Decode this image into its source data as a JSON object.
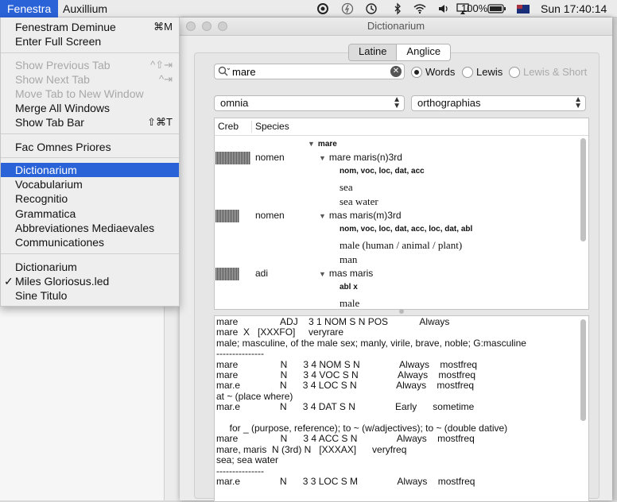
{
  "menubar": {
    "menus": [
      "Fenestra",
      "Auxillium"
    ],
    "battery": "100%",
    "clock": "Sun 17:40:14"
  },
  "window": {
    "title": "Dictionarium",
    "tabs": [
      "Latine",
      "Anglice"
    ],
    "search_value": "mare",
    "radios": [
      "Words",
      "Lewis",
      "Lewis & Short"
    ],
    "select_left": "omnia",
    "select_right": "orthographias",
    "columns": [
      "Creb",
      "Species"
    ],
    "outline": {
      "r0": "mare",
      "r1_species": "nomen",
      "r1": "mare maris(n)3rd",
      "r1_forms": "nom, voc, loc, dat, acc",
      "r1_m1": "sea",
      "r1_m2": "sea water",
      "r2_species": "nomen",
      "r2": "mas maris(m)3rd",
      "r2_forms": "nom, voc, loc, dat, acc, loc, dat, abl",
      "r2_m1": "male (human / animal / plant)",
      "r2_m2": "man",
      "r3_species": "adi",
      "r3": "mas maris",
      "r3_forms": "abl x",
      "r3_m1": "male"
    },
    "text_output": "mare                ADJ    3 1 NOM S N POS            Always\nmare  X   [XXXFO]     veryrare\nmale; masculine, of the male sex; manly, virile, brave, noble; G:masculine\n---------------\nmare                N      3 4 NOM S N               Always    mostfreq\nmare                N      3 4 VOC S N               Always    mostfreq\nmar.e               N      3 4 LOC S N               Always    mostfreq\nat ~ (place where)\nmar.e               N      3 4 DAT S N               Early      sometime\n\n     for _ (purpose, reference); to ~ (w/adjectives); to ~ (double dative)\nmare                N      3 4 ACC S N               Always    mostfreq\nmare, maris  N (3rd) N   [XXXAX]      veryfreq\nsea; sea water\n---------------\nmar.e               N      3 3 LOC S M               Always    mostfreq"
  },
  "fenestra_menu": {
    "g1": [
      {
        "label": "Fenestram Deminue",
        "shortcut": "⌘M"
      },
      {
        "label": "Enter Full Screen",
        "shortcut": ""
      }
    ],
    "g2": [
      {
        "label": "Show Previous Tab",
        "shortcut": "^⇧⇥"
      },
      {
        "label": "Show Next Tab",
        "shortcut": "^⇥"
      },
      {
        "label": "Move Tab to New Window",
        "shortcut": ""
      },
      {
        "label": "Merge All Windows",
        "shortcut": ""
      },
      {
        "label": "Show Tab Bar",
        "shortcut": "⇧⌘T"
      }
    ],
    "g3": [
      {
        "label": "Fac Omnes Priores",
        "shortcut": ""
      }
    ],
    "g4": [
      {
        "label": "Dictionarium"
      },
      {
        "label": "Vocabularium"
      },
      {
        "label": "Recognitio"
      },
      {
        "label": "Grammatica"
      },
      {
        "label": "Abbreviationes Mediaevales"
      },
      {
        "label": "Communicationes"
      }
    ],
    "g5": [
      {
        "label": "Dictionarium"
      },
      {
        "label": "Miles Gloriosus.led"
      },
      {
        "label": "Sine Titulo"
      }
    ]
  }
}
